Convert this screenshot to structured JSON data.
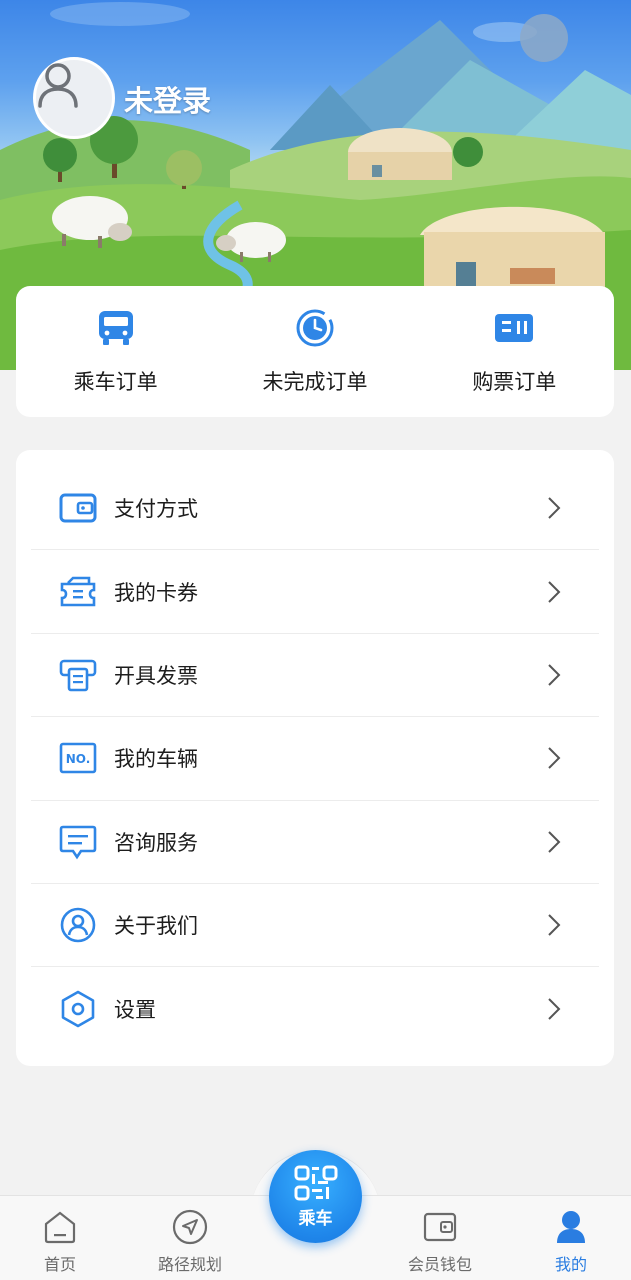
{
  "profile": {
    "login_status": "未登录",
    "avatar_icon": "user-placeholder-icon"
  },
  "orders": [
    {
      "label": "乘车订单",
      "icon": "bus-icon"
    },
    {
      "label": "未完成订单",
      "icon": "clock-icon"
    },
    {
      "label": "购票订单",
      "icon": "ticket-icon"
    }
  ],
  "menu": [
    {
      "label": "支付方式",
      "icon": "wallet-icon"
    },
    {
      "label": "我的卡券",
      "icon": "coupon-icon"
    },
    {
      "label": "开具发票",
      "icon": "invoice-icon"
    },
    {
      "label": "我的车辆",
      "icon": "plate-icon",
      "icon_text": "NO."
    },
    {
      "label": "咨询服务",
      "icon": "chat-icon"
    },
    {
      "label": "关于我们",
      "icon": "user-circle-icon"
    },
    {
      "label": "设置",
      "icon": "settings-icon"
    }
  ],
  "tabbar": {
    "tabs": [
      {
        "label": "首页",
        "icon": "home-icon"
      },
      {
        "label": "路径规划",
        "icon": "navigate-icon"
      },
      {
        "label": "会员钱包",
        "icon": "wallet-icon"
      },
      {
        "label": "我的",
        "icon": "profile-icon",
        "active": true
      }
    ],
    "center": {
      "label": "乘车",
      "icon": "qr-code-icon"
    }
  },
  "colors": {
    "accent": "#2a7de1",
    "icon_blue": "#2f86e6",
    "background": "#f2f2f2"
  }
}
